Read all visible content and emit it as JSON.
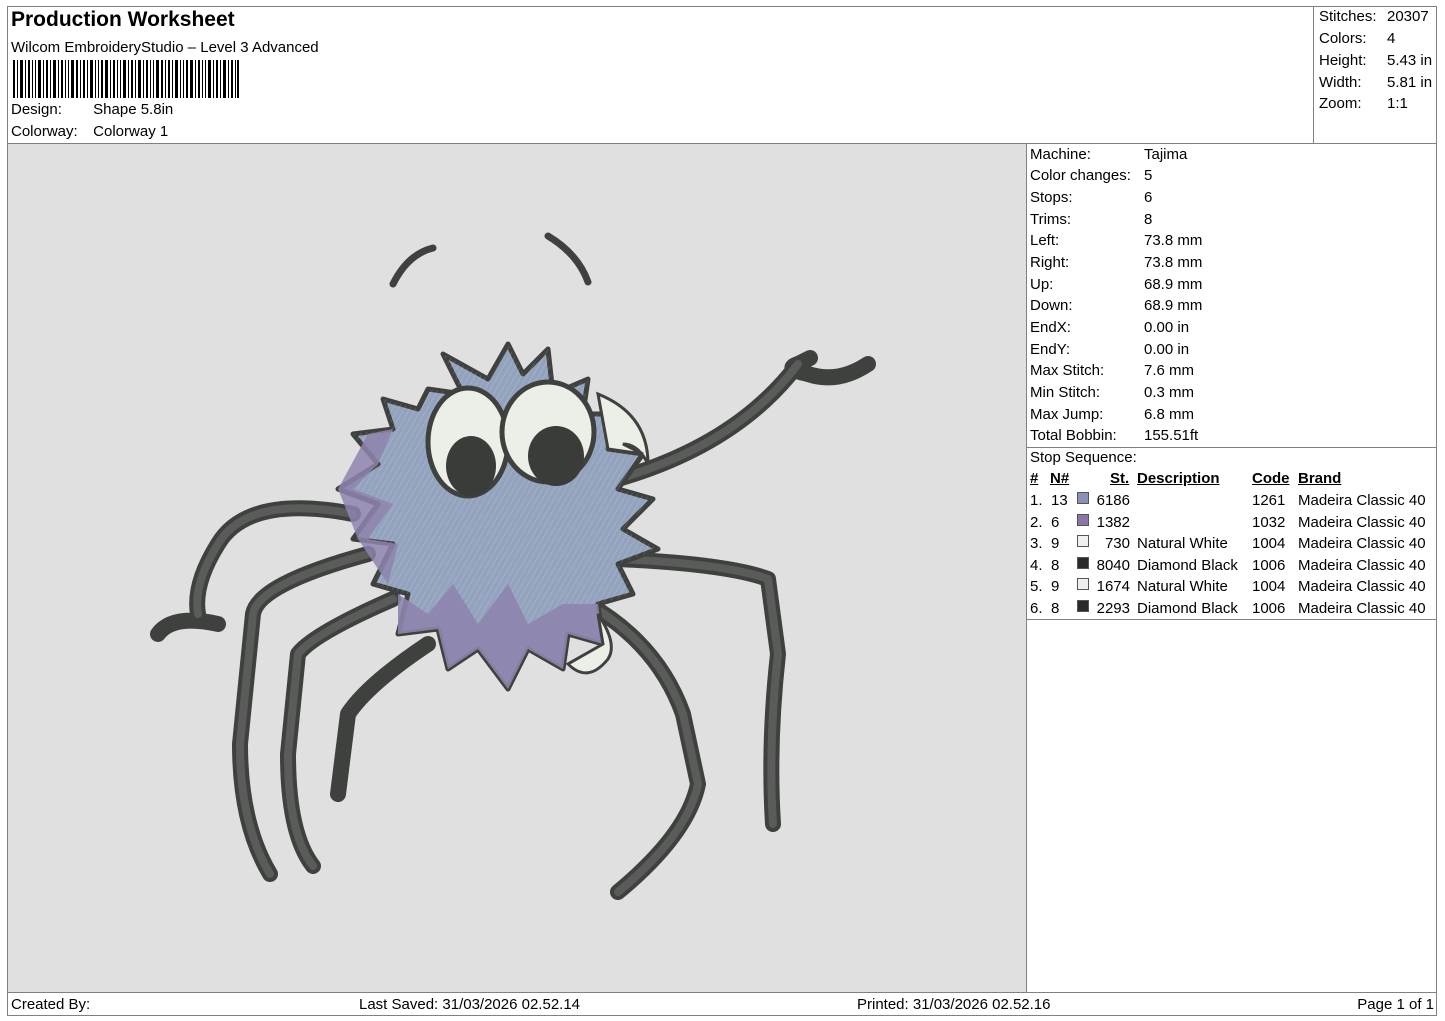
{
  "header": {
    "title": "Production Worksheet",
    "subtitle": "Wilcom EmbroideryStudio – Level 3 Advanced",
    "design_label": "Design:",
    "design_value": "Shape 5.8in",
    "colorway_label": "Colorway:",
    "colorway_value": "Colorway 1"
  },
  "summary": {
    "stitches_label": "Stitches:",
    "stitches": "20307",
    "colors_label": "Colors:",
    "colors": "4",
    "height_label": "Height:",
    "height": "5.43 in",
    "width_label": "Width:",
    "width": "5.81 in",
    "zoom_label": "Zoom:",
    "zoom": "1:1"
  },
  "details": {
    "machine_label": "Machine:",
    "machine": "Tajima",
    "color_changes_label": "Color changes:",
    "color_changes": "5",
    "stops_label": "Stops:",
    "stops": "6",
    "trims_label": "Trims:",
    "trims": "8",
    "left_label": "Left:",
    "left": "73.8 mm",
    "right_label": "Right:",
    "right": "73.8 mm",
    "up_label": "Up:",
    "up": "68.9 mm",
    "down_label": "Down:",
    "down": "68.9 mm",
    "endx_label": "EndX:",
    "endx": "0.00 in",
    "endy_label": "EndY:",
    "endy": "0.00 in",
    "max_stitch_label": "Max Stitch:",
    "max_stitch": "7.6 mm",
    "min_stitch_label": "Min Stitch:",
    "min_stitch": "0.3 mm",
    "max_jump_label": "Max Jump:",
    "max_jump": "6.8 mm",
    "total_bobbin_label": "Total Bobbin:",
    "total_bobbin": "155.51ft"
  },
  "stop_sequence": {
    "heading": "Stop Sequence:",
    "columns": {
      "num": "#",
      "n": "N#",
      "st": "St.",
      "description": "Description",
      "code": "Code",
      "brand": "Brand"
    },
    "rows": [
      {
        "num": "1.",
        "n": "13",
        "color": "#8a90b8",
        "st": "6186",
        "description": "",
        "code": "1261",
        "brand": "Madeira Classic 40"
      },
      {
        "num": "2.",
        "n": "6",
        "color": "#8c73a8",
        "st": "1382",
        "description": "",
        "code": "1032",
        "brand": "Madeira Classic 40"
      },
      {
        "num": "3.",
        "n": "9",
        "color": "#f0f0f0",
        "st": "730",
        "description": "Natural White",
        "code": "1004",
        "brand": "Madeira Classic 40"
      },
      {
        "num": "4.",
        "n": "8",
        "color": "#2a2a2a",
        "st": "8040",
        "description": "Diamond Black",
        "code": "1006",
        "brand": "Madeira Classic 40"
      },
      {
        "num": "5.",
        "n": "9",
        "color": "#f0f0f0",
        "st": "1674",
        "description": "Natural White",
        "code": "1004",
        "brand": "Madeira Classic 40"
      },
      {
        "num": "6.",
        "n": "8",
        "color": "#2a2a2a",
        "st": "2293",
        "description": "Diamond Black",
        "code": "1006",
        "brand": "Madeira Classic 40"
      }
    ]
  },
  "footer": {
    "created_by": "Created By:",
    "last_saved": "Last Saved: 31/03/2026 02.52.14",
    "printed": "Printed: 31/03/2026 02.52.16",
    "page": "Page 1 of 1"
  },
  "colors": {
    "canvas_bg": "#e0e0e0",
    "leg_color": "#4a4c4a",
    "body_blue": "#93a3bd",
    "body_purple": "#8e84ad",
    "highlight_white": "#eceee8"
  }
}
